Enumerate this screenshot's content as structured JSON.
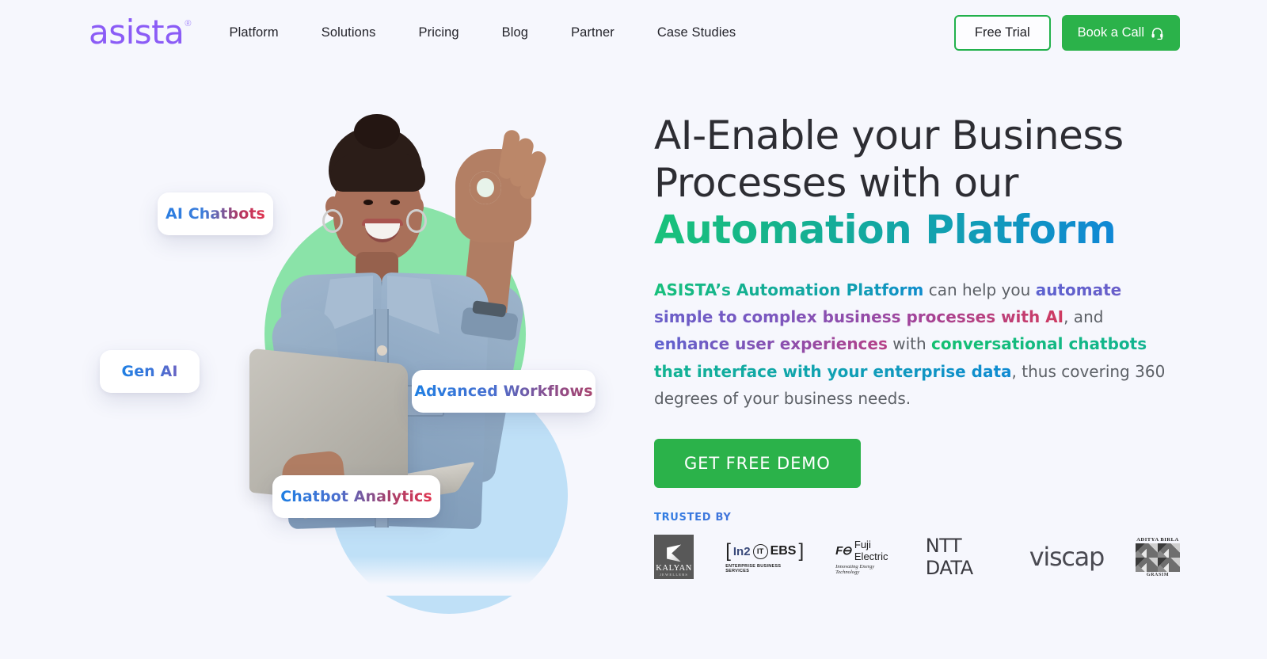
{
  "header": {
    "brand": {
      "name": "asista",
      "trademark": "®"
    },
    "nav": [
      {
        "label": "Platform"
      },
      {
        "label": "Solutions"
      },
      {
        "label": "Pricing"
      },
      {
        "label": "Blog"
      },
      {
        "label": "Partner"
      },
      {
        "label": "Case Studies"
      }
    ],
    "free_trial_label": "Free Trial",
    "book_call_label": "Book a Call",
    "book_call_icon": "headset-icon"
  },
  "hero": {
    "title_line1": "AI-Enable your Business",
    "title_line2": "Processes with our",
    "title_accent": "Automation Platform",
    "desc": {
      "s1": "ASISTA’s Automation Platform",
      "s2": " can help you ",
      "s3": "automate simple to  complex business processes with AI",
      "s4": ", and ",
      "s5": "enhance user experiences",
      "s6": " with ",
      "s7": "conversational chatbots that interface with your enterprise data",
      "s8": ", thus covering 360 degrees of your business needs."
    },
    "cta_label": "GET FREE DEMO",
    "trusted_by_label": "TRUSTED BY",
    "chips": [
      {
        "label": "AI Chatbots",
        "name": "chip-ai-chatbots"
      },
      {
        "label": "Gen AI",
        "name": "chip-gen-ai"
      },
      {
        "label": "Advanced Workflows",
        "name": "chip-advanced-workflows"
      },
      {
        "label": "Chatbot Analytics",
        "name": "chip-chatbot-analytics"
      }
    ],
    "logos": [
      {
        "name": "KALYAN",
        "sub": "JEWELLERS"
      },
      {
        "name": "In2",
        "mid": "IT",
        "suffix": "EBS",
        "sub": "ENTERPRISE BUSINESS SERVICES"
      },
      {
        "name": "Fuji Electric",
        "sub": "Innovating Energy Technology"
      },
      {
        "name": "NTT DATA"
      },
      {
        "name": "viscap"
      },
      {
        "name": "ADITYA BIRLA",
        "sub": "GRASIM"
      }
    ],
    "image_alt": "woman-with-laptop-photo"
  },
  "colors": {
    "background": "#f6f7fd",
    "brand_purple": "#8b5cf6",
    "green_cta": "#2bb24a",
    "accent_green": "#19c27a",
    "accent_blue": "#0f87d6",
    "blob_green": "#8ae3a8",
    "blob_blue": "#bfe0f7"
  }
}
